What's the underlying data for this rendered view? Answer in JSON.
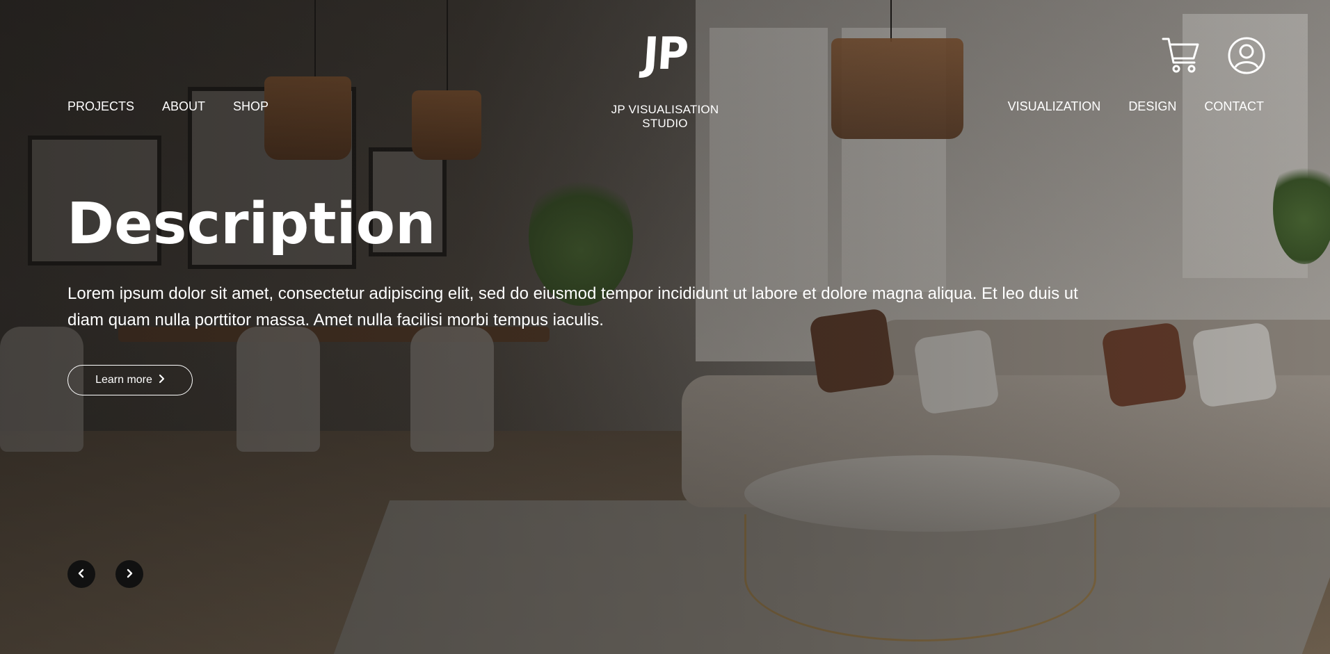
{
  "header": {
    "logo": "JP",
    "studio_name": "JP VISUALISATION STUDIO",
    "nav_left": [
      "PROJECTS",
      "ABOUT",
      "SHOP"
    ],
    "nav_right": [
      "VISUALIZATION",
      "DESIGN",
      "CONTACT"
    ],
    "icons": [
      "cart-icon",
      "user-account-icon"
    ]
  },
  "hero": {
    "title": "Description",
    "description": "Lorem ipsum dolor sit amet, consectetur adipiscing elit, sed do eiusmod tempor incididunt ut labore et dolore magna aliqua. Et leo duis ut diam quam nulla porttitor massa. Amet nulla facilisi morbi tempus iaculis.",
    "cta_label": "Learn more",
    "cta_icon": "chevron-right-icon",
    "carousel_controls": [
      "chevron-left-icon",
      "chevron-right-icon"
    ]
  },
  "colors": {
    "text": "#ffffff",
    "control_bg": "#111111"
  }
}
